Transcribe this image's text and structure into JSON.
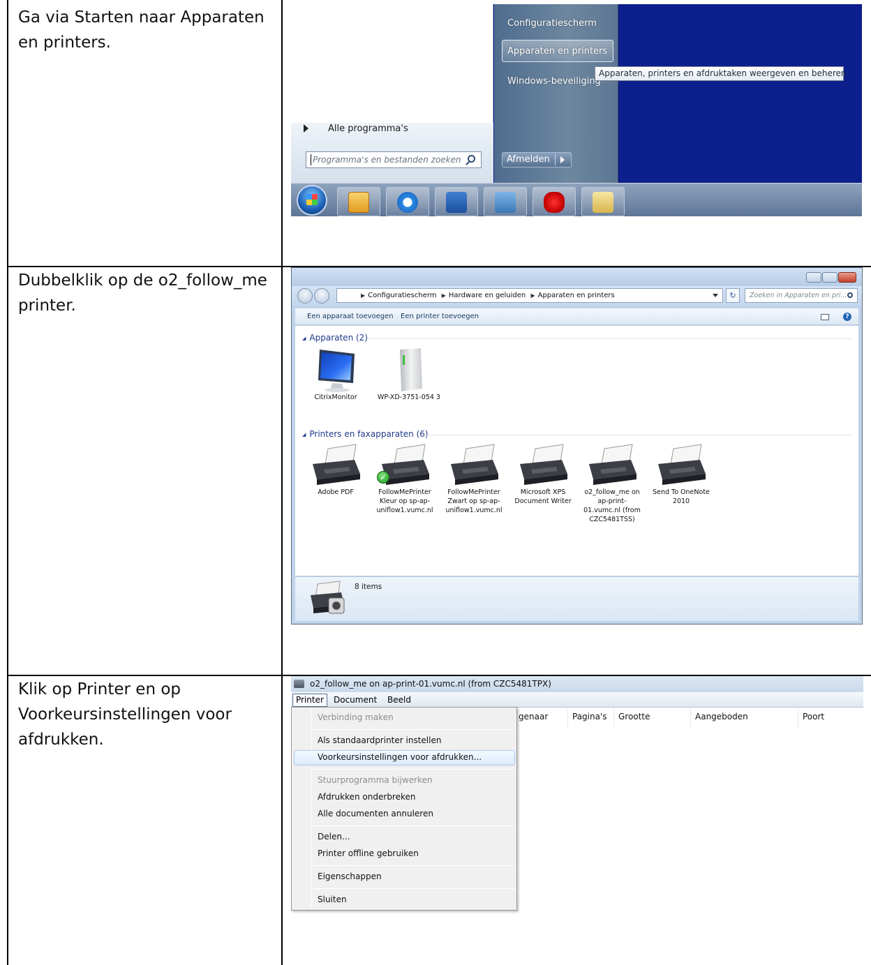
{
  "instructions": {
    "step1": "Ga via Starten naar Apparaten en printers.",
    "step2": "Dubbelklik op de o2_follow_me printer.",
    "step3": "Klik op Printer en op Voorkeursinstellingen voor afdrukken."
  },
  "start_menu": {
    "right_items": [
      "Configuratiescherm",
      "Apparaten en printers",
      "Windows-beveiliging"
    ],
    "tooltip": "Apparaten, printers en afdruktaken weergeven en beheren",
    "all_programs": "Alle programma's",
    "search_placeholder": "Programma's en bestanden zoeken",
    "logoff_label": "Afmelden",
    "taskbar_icons": [
      "start-orb-icon",
      "outlook-icon",
      "internet-explorer-icon",
      "lync-icon",
      "remote-desktop-icon",
      "red-app-icon",
      "file-explorer-icon"
    ],
    "colors": {
      "desktop": "#0c1f8c",
      "taskbar": "#6b82a2"
    }
  },
  "devices_window": {
    "breadcrumb": [
      "Configuratiescherm",
      "Hardware en geluiden",
      "Apparaten en printers"
    ],
    "search_placeholder": "Zoeken in Apparaten en pri...",
    "commands": [
      "Een apparaat toevoegen",
      "Een printer toevoegen"
    ],
    "group_devices": "Apparaten (2)",
    "devices": [
      {
        "name": "CitrixMonitor"
      },
      {
        "name": "WP-XD-3751-054 3"
      }
    ],
    "group_printers": "Printers en faxapparaten (6)",
    "printers": [
      {
        "name": "Adobe PDF",
        "default": false
      },
      {
        "name": "FollowMePrinter Kleur op sp-ap-uniflow1.vumc.nl",
        "default": true
      },
      {
        "name": "FollowMePrinter Zwart op sp-ap-uniflow1.vumc.nl",
        "default": false
      },
      {
        "name": "Microsoft XPS Document Writer",
        "default": false
      },
      {
        "name": "o2_follow_me on ap-print-01.vumc.nl (from CZC5481TSS)",
        "default": false
      },
      {
        "name": "Send To OneNote 2010",
        "default": false
      }
    ],
    "status_count": "8 items"
  },
  "print_queue": {
    "title": "o2_follow_me on ap-print-01.vumc.nl (from CZC5481TPX)",
    "menu": [
      "Printer",
      "Document",
      "Beeld"
    ],
    "columns": [
      "genaar",
      "Pagina's",
      "Grootte",
      "Aangeboden",
      "Poort"
    ],
    "printer_menu": [
      {
        "label": "Verbinding maken",
        "disabled": true
      },
      {
        "label": "Als standaardprinter instellen",
        "disabled": false
      },
      {
        "label": "Voorkeursinstellingen voor afdrukken...",
        "disabled": false,
        "highlighted": true
      },
      {
        "label": "Stuurprogramma bijwerken",
        "disabled": true
      },
      {
        "label": "Afdrukken onderbreken",
        "disabled": false
      },
      {
        "label": "Alle documenten annuleren",
        "disabled": false
      },
      {
        "label": "Delen...",
        "disabled": false
      },
      {
        "label": "Printer offline gebruiken",
        "disabled": false
      },
      {
        "label": "Eigenschappen",
        "disabled": false
      },
      {
        "label": "Sluiten",
        "disabled": false
      }
    ]
  }
}
